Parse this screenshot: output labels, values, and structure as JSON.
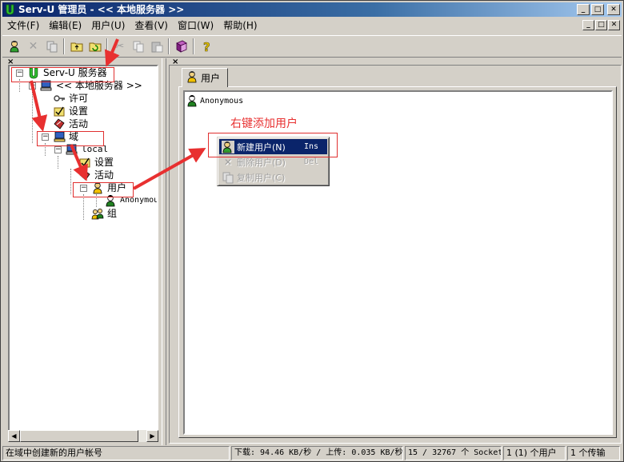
{
  "window": {
    "title": "Serv-U 管理员 - << 本地服务器 >>",
    "minimize": "_",
    "maximize": "□",
    "close": "✕"
  },
  "menu": [
    "文件(F)",
    "编辑(E)",
    "用户(U)",
    "查看(V)",
    "窗口(W)",
    "帮助(H)"
  ],
  "toolbar_icons": [
    "new-user-icon",
    "delete-icon",
    "copy-user-icon",
    "up-folder-icon",
    "refresh-icon",
    "cut-icon",
    "copy-icon",
    "paste-icon",
    "book-icon",
    "help-icon"
  ],
  "tree": {
    "root": "Serv-U 服务器",
    "server": "<< 本地服务器 >>",
    "license": "许可",
    "settings": "设置",
    "activity": "活动",
    "domains": "域",
    "domain_name": "local",
    "domain_settings": "设置",
    "domain_activity": "活动",
    "users": "用户",
    "user_anonymous": "Anonymous",
    "groups": "组"
  },
  "right_pane": {
    "tab_label": "用户",
    "users": [
      "Anonymous"
    ]
  },
  "context_menu": [
    {
      "label": "新建用户(N)",
      "shortcut": "Ins",
      "state": "selected"
    },
    {
      "label": "删除用户(D)",
      "shortcut": "Del",
      "state": "disabled"
    },
    {
      "label": "复制用户(C)",
      "shortcut": "",
      "state": "disabled"
    }
  ],
  "annotation": {
    "text": "右键添加用户",
    "color": "#e83030"
  },
  "statusbar": {
    "hint": "在域中创建新的用户帐号",
    "speed": "下载: 94.46 KB/秒 / 上传: 0.035 KB/秒",
    "sockets": "15 / 32767 个 Socket",
    "users": "1 (1) 个用户",
    "transfers": "1 个传输"
  },
  "colors": {
    "titlebar": "#0a246a",
    "menu_highlight": "#0a246a",
    "annotation": "#e03030"
  }
}
